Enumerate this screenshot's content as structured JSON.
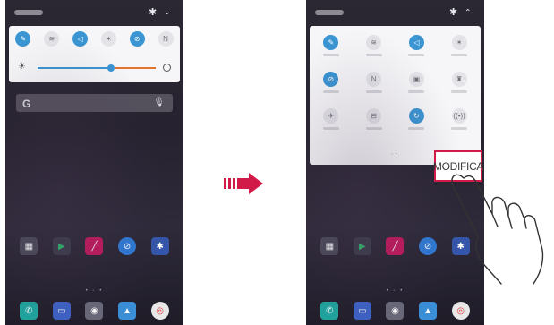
{
  "edit_button_label": "MODIFICA",
  "search": {
    "logo": "G",
    "mic_icon": "mic-icon"
  },
  "colors": {
    "accent": "#3a95d2",
    "highlight": "#d11a47",
    "arrow": "#d11a47",
    "brightness_high": "#e07430"
  },
  "left_phone": {
    "quick_settings": [
      {
        "icon": "edit-icon",
        "on": true
      },
      {
        "icon": "wifi-icon",
        "on": false
      },
      {
        "icon": "sound-icon",
        "on": true
      },
      {
        "icon": "bluetooth-icon",
        "on": false
      },
      {
        "icon": "do-not-disturb-icon",
        "on": true
      },
      {
        "icon": "nfc-icon",
        "on": false
      }
    ]
  },
  "right_phone": {
    "quick_settings": [
      {
        "icon": "edit-icon",
        "on": true
      },
      {
        "icon": "wifi-icon",
        "on": false
      },
      {
        "icon": "sound-icon",
        "on": true
      },
      {
        "icon": "bluetooth-icon",
        "on": false
      },
      {
        "icon": "do-not-disturb-icon",
        "on": true
      },
      {
        "icon": "nfc-icon",
        "on": false
      },
      {
        "icon": "sim-icon",
        "on": false
      },
      {
        "icon": "flashlight-icon",
        "on": false
      },
      {
        "icon": "airplane-icon",
        "on": false
      },
      {
        "icon": "screen-recorder-icon",
        "on": false
      },
      {
        "icon": "sync-icon",
        "on": true
      },
      {
        "icon": "hotspot-icon",
        "on": false
      }
    ]
  }
}
